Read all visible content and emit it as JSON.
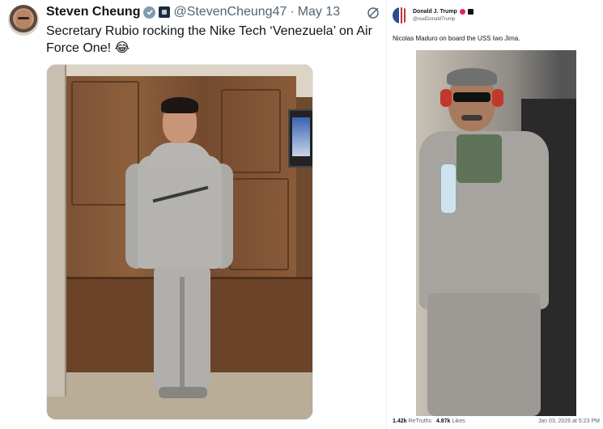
{
  "left_tweet": {
    "author_name": "Steven Cheung",
    "handle": "@StevenCheung47",
    "separator": "·",
    "date": "May 13",
    "text": "Secretary Rubio rocking the Nike Tech ‘Venezuela’ on Air Force One! 😂",
    "icons": {
      "verified": "verified-badge-icon",
      "affiliation": "government-affiliation-icon",
      "grok": "grok-icon"
    },
    "colors": {
      "verified_badge": "#829aab",
      "muted_text": "#536471"
    }
  },
  "right_tweet": {
    "author_name": "Donald J. Trump",
    "handle": "@realDonaldTrump",
    "text": "Nicolas Maduro on board the USS Iwo Jima.",
    "retruths_count": "1.42k",
    "retruths_label": "ReTruths",
    "likes_count": "4.87k",
    "likes_label": "Likes",
    "timestamp": "Jan 03, 2026 at 5:23 PM"
  }
}
